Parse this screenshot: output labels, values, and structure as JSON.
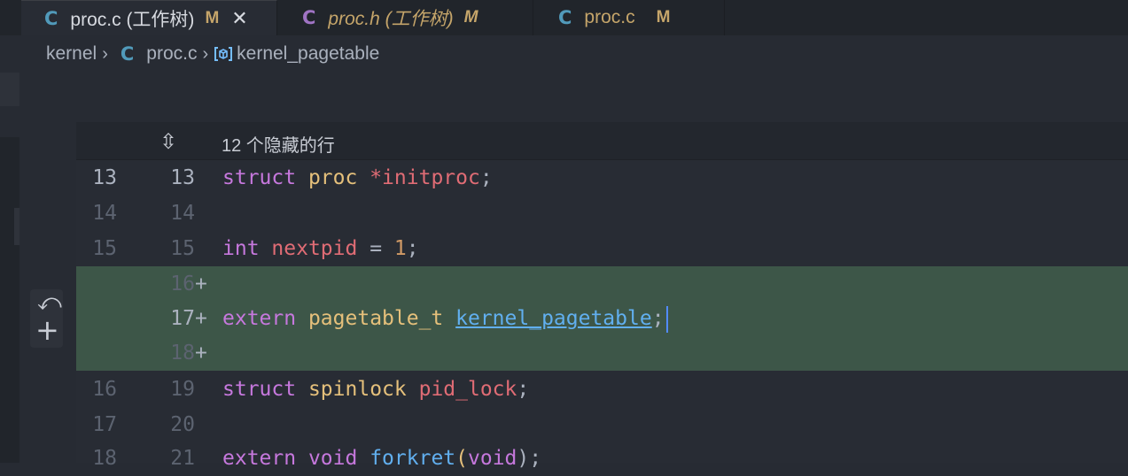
{
  "tabs": [
    {
      "icon": "C",
      "title": "proc.c (工作树)",
      "badge": "M",
      "close": "✕"
    },
    {
      "icon": "C",
      "title": "proc.h (工作树)",
      "badge": "M"
    },
    {
      "icon": "C",
      "title": "proc.c",
      "badge": "M"
    }
  ],
  "breadcrumb": {
    "folder": "kernel",
    "file_icon": "C",
    "file": "proc.c",
    "symbol": "kernel_pagetable"
  },
  "hidden_lines_label": "12 个隐藏的行",
  "rows": [
    {
      "old": "13",
      "new": "13"
    },
    {
      "old": "14",
      "new": "14"
    },
    {
      "old": "15",
      "new": "15"
    },
    {
      "old": "",
      "new": "16",
      "plus": "+"
    },
    {
      "old": "",
      "new": "17",
      "plus": "+"
    },
    {
      "old": "",
      "new": "18",
      "plus": "+"
    },
    {
      "old": "16",
      "new": "19"
    },
    {
      "old": "17",
      "new": "20"
    },
    {
      "old": "18",
      "new": "21"
    }
  ],
  "code": {
    "l13": {
      "kw": "struct",
      "ty": "proc",
      "id": "*initproc",
      "punct": ";"
    },
    "l15": {
      "kw": "int",
      "id": "nextpid",
      "eq": " = ",
      "num": "1",
      "punct": ";"
    },
    "l17": {
      "kw": "extern",
      "ty": "pagetable_t",
      "link": "kernel_pagetable",
      "punct": ";"
    },
    "l19": {
      "kw": "struct",
      "ty": "spinlock",
      "id": "pid_lock",
      "punct": ";"
    },
    "l21": {
      "kw1": "extern",
      "kw2": "void",
      "fn": "forkret",
      "open": "(",
      "arg": "void",
      "close": ");"
    }
  },
  "colors": {
    "added_bg": "#3d5648",
    "accent": "#61afef",
    "keyword": "#c678dd"
  }
}
